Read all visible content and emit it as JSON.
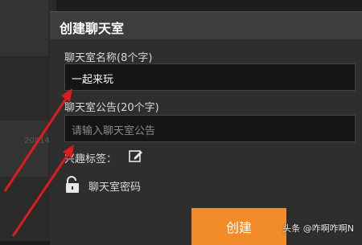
{
  "background": {
    "number_text": "20814"
  },
  "dialog": {
    "title": "创建聊天室",
    "name_label": "聊天室名称(8个字)",
    "name_value": "一起来玩",
    "notice_label": "聊天室公告(20个字)",
    "notice_placeholder": "请输入聊天室公告",
    "tags_label": "兴趣标签：",
    "password_label": "聊天室密码",
    "create_button": "创建"
  },
  "watermark": "头条 @咋啊咋啊N",
  "colors": {
    "accent": "#f28c2b",
    "annotation": "#e01b1b"
  }
}
